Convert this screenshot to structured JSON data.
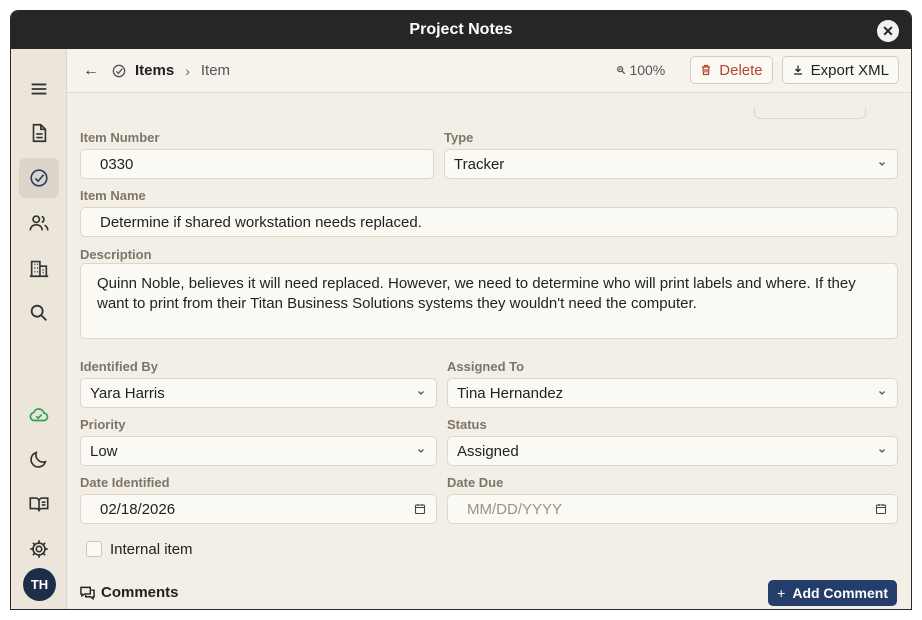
{
  "window": {
    "title": "Project Notes",
    "close_glyph": "✕"
  },
  "sidebar": {
    "items": [
      {
        "name": "menu-icon"
      },
      {
        "name": "document-icon"
      },
      {
        "name": "check-circle-icon",
        "active": true
      },
      {
        "name": "people-icon"
      },
      {
        "name": "building-icon"
      },
      {
        "name": "search-icon"
      },
      {
        "name": "cloud-check-icon"
      },
      {
        "name": "moon-icon"
      },
      {
        "name": "book-icon"
      },
      {
        "name": "gear-icon"
      }
    ],
    "avatar_initials": "TH"
  },
  "toolbar": {
    "back_glyph": "←",
    "breadcrumb": {
      "items_label": "Items",
      "separator": "›",
      "current": "Item"
    },
    "zoom": "100%",
    "delete_label": "Delete",
    "export_label": "Export XML"
  },
  "form": {
    "item_number": {
      "label": "Item Number",
      "value": "0330"
    },
    "type": {
      "label": "Type",
      "value": "Tracker"
    },
    "item_name": {
      "label": "Item Name",
      "value": "Determine if shared workstation needs replaced."
    },
    "description": {
      "label": "Description",
      "value": "Quinn Noble, believes it will need replaced. However, we need to determine who will print labels and where. If they want to print from their Titan Business Solutions systems they wouldn't need the computer."
    },
    "identified_by": {
      "label": "Identified By",
      "value": "Yara Harris"
    },
    "assigned_to": {
      "label": "Assigned To",
      "value": "Tina Hernandez"
    },
    "priority": {
      "label": "Priority",
      "value": "Low"
    },
    "status": {
      "label": "Status",
      "value": "Assigned"
    },
    "date_identified": {
      "label": "Date Identified",
      "value": "02/18/2026"
    },
    "date_due": {
      "label": "Date Due",
      "placeholder": "MM/DD/YYYY"
    },
    "internal_item": {
      "label": "Internal item",
      "checked": false
    }
  },
  "comments": {
    "title": "Comments",
    "add_label": "Add Comment",
    "add_glyph": "+"
  },
  "colors": {
    "accent": "#243d6b",
    "delete": "#b5452f",
    "cloud_ok": "#2e9e5b"
  }
}
